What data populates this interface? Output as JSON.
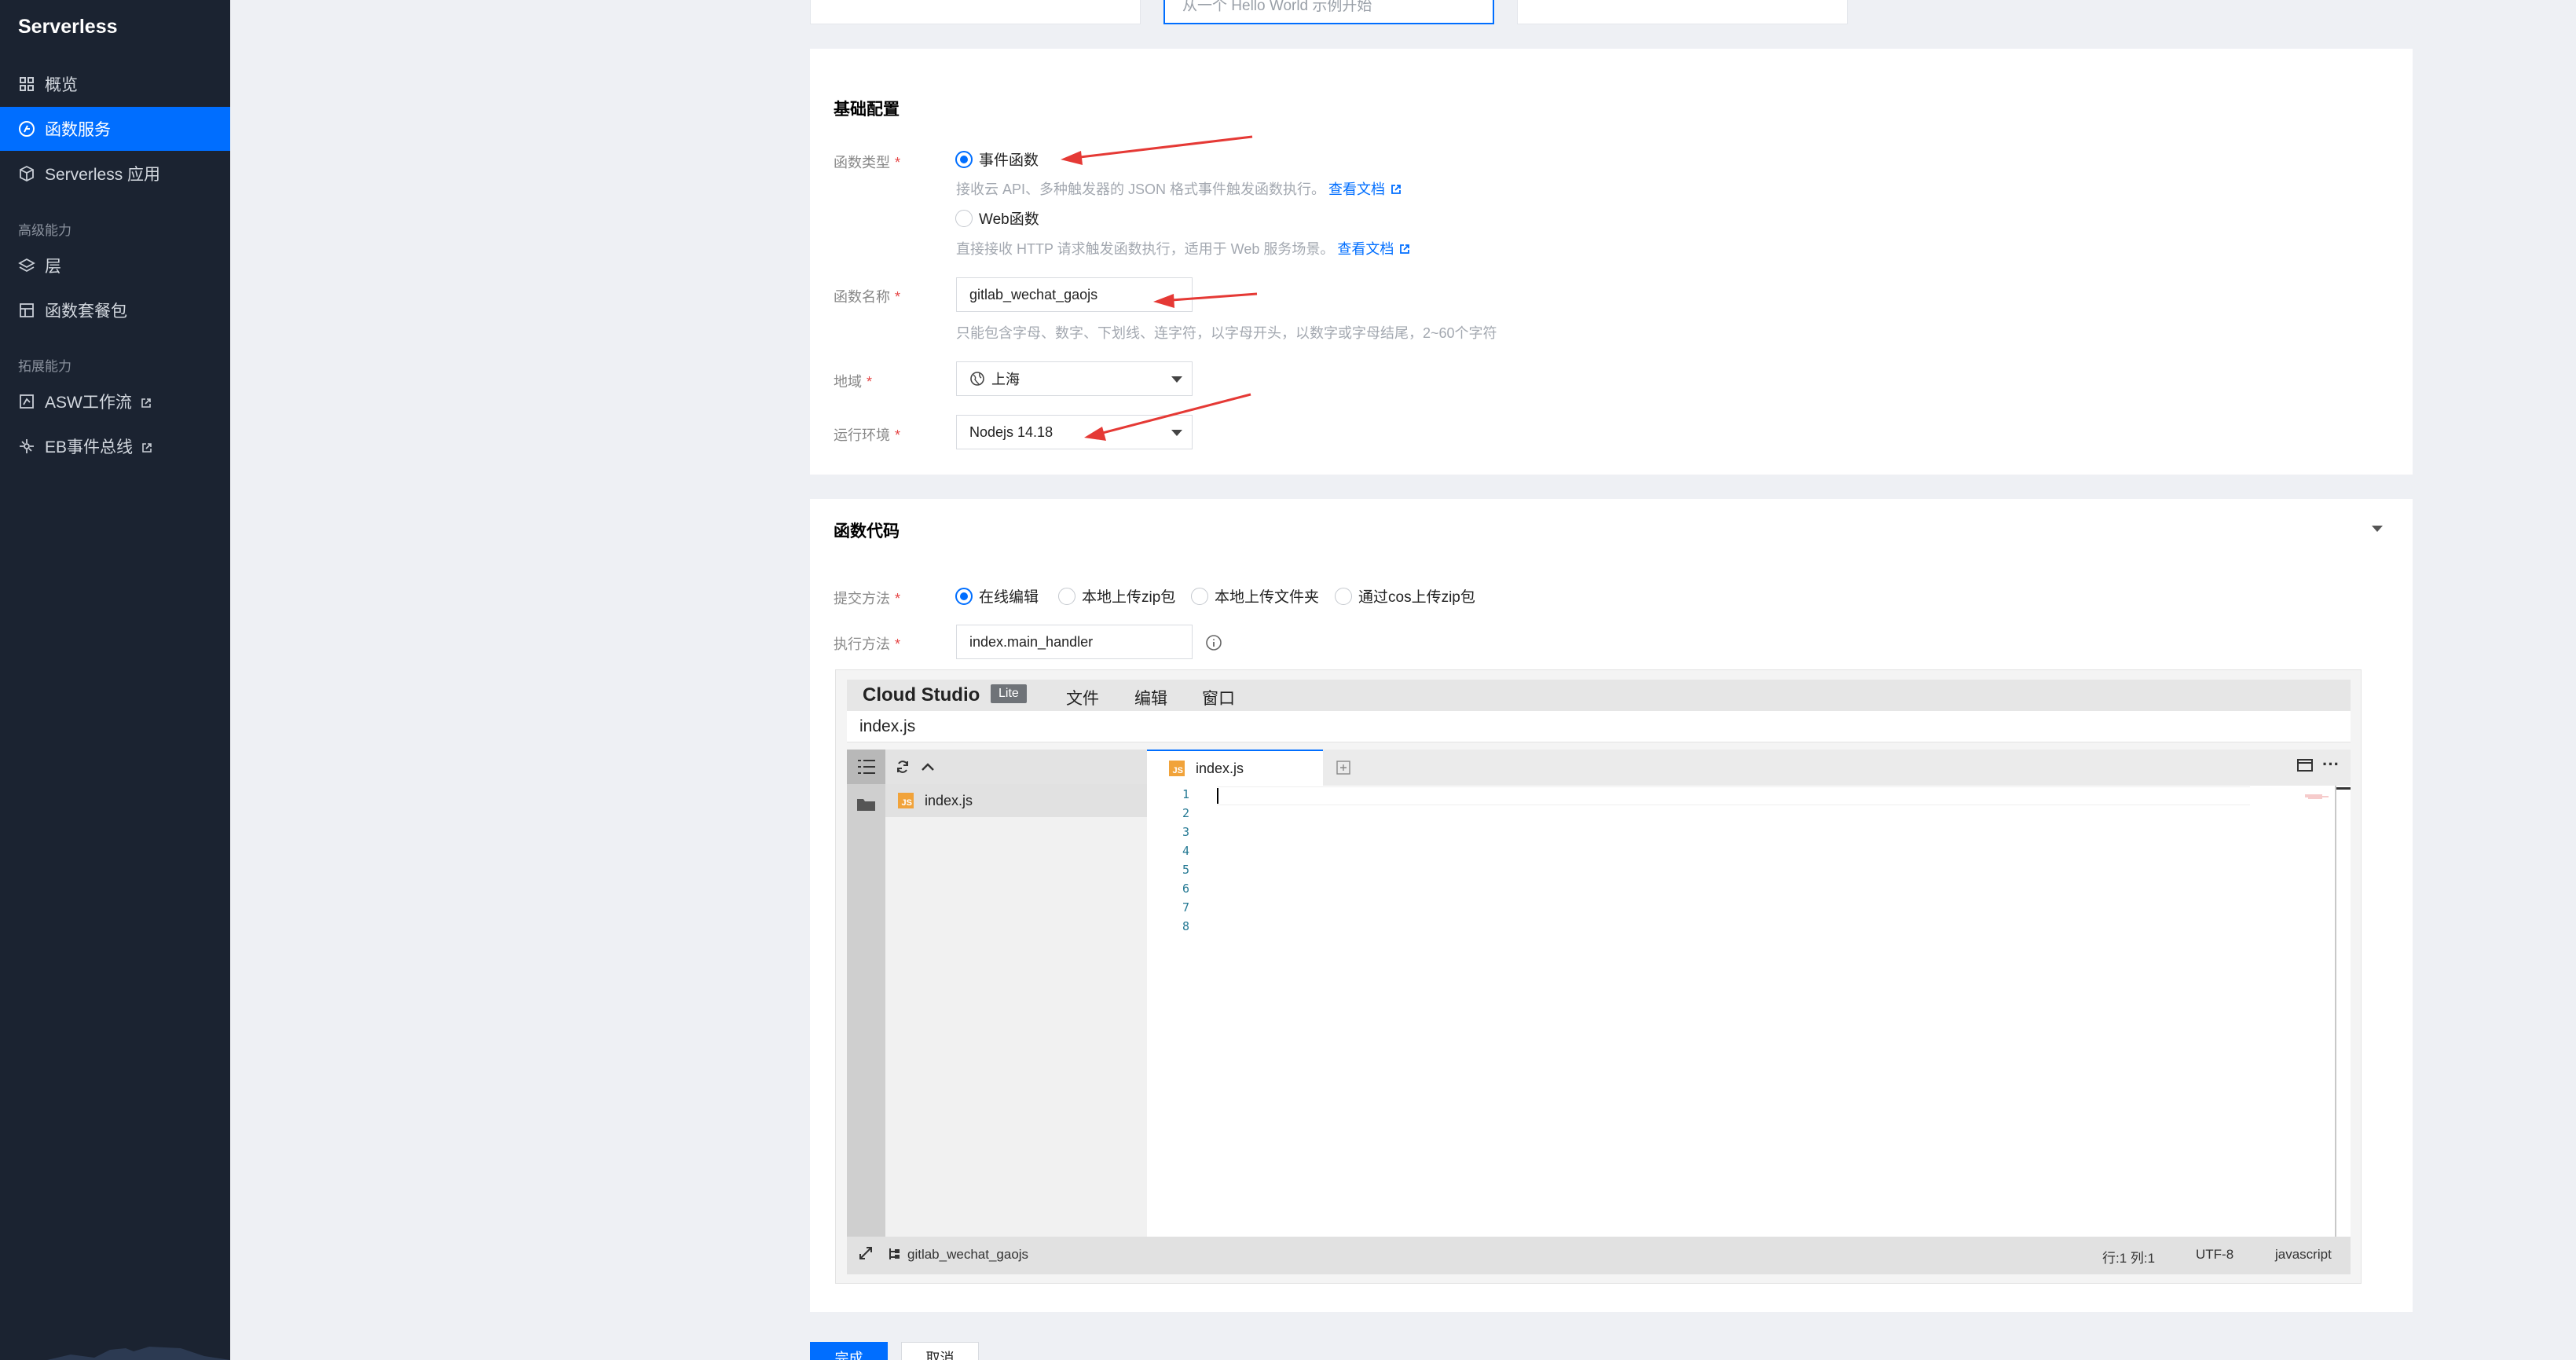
{
  "sidebar": {
    "brand": "Serverless",
    "items": [
      {
        "label": "概览"
      },
      {
        "label": "函数服务"
      },
      {
        "label": "Serverless 应用"
      }
    ],
    "group_advanced": "高级能力",
    "advanced_items": [
      {
        "label": "层"
      },
      {
        "label": "函数套餐包"
      }
    ],
    "group_extend": "拓展能力",
    "extend_items": [
      {
        "label": "ASW工作流"
      },
      {
        "label": "EB事件总线"
      }
    ]
  },
  "templates": {
    "card2_text": "从一个 Hello World 示例开始"
  },
  "basic_config": {
    "title": "基础配置",
    "func_type_label": "函数类型",
    "event_func": "事件函数",
    "event_func_hint": "接收云 API、多种触发器的 JSON 格式事件触发函数执行。",
    "web_func": "Web函数",
    "web_func_hint": "直接接收 HTTP 请求触发函数执行，适用于 Web 服务场景。",
    "doc_link": "查看文档",
    "func_name_label": "函数名称",
    "func_name_value": "gitlab_wechat_gaojs",
    "func_name_hint": "只能包含字母、数字、下划线、连字符，以字母开头，以数字或字母结尾，2~60个字符",
    "region_label": "地域",
    "region_value": "上海",
    "runtime_label": "运行环境",
    "runtime_value": "Nodejs 14.18"
  },
  "func_code": {
    "title": "函数代码",
    "submit_label": "提交方法",
    "submit_options": [
      "在线编辑",
      "本地上传zip包",
      "本地上传文件夹",
      "通过cos上传zip包"
    ],
    "handler_label": "执行方法",
    "handler_value": "index.main_handler"
  },
  "ide": {
    "brand": "Cloud Studio",
    "badge": "Lite",
    "menus": [
      "文件",
      "编辑",
      "窗口"
    ],
    "path": "index.js",
    "explorer_file": "index.js",
    "tab_file": "index.js",
    "js_badge": "JS",
    "line_numbers": [
      "1",
      "2",
      "3",
      "4",
      "5",
      "6",
      "7",
      "8"
    ],
    "status_project": "gitlab_wechat_gaojs",
    "status_position": "行:1 列:1",
    "status_encoding": "UTF-8",
    "status_language": "javascript"
  },
  "footer": {
    "confirm": "完成",
    "cancel": "取消"
  }
}
